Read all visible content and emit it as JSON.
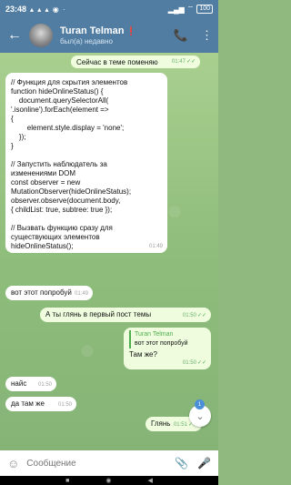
{
  "statusbar": {
    "time": "23:48",
    "icons": "▴ ▴ ▴ ◉ ·",
    "signal": "▂▄▆",
    "wifi": "⌔",
    "battery": "100"
  },
  "header": {
    "back_icon": "←",
    "name": "Turan Telman",
    "badge": "❗",
    "status": "был(а) недавно",
    "call_icon": "📞",
    "menu_icon": "⋮"
  },
  "messages": [
    {
      "id": "m1",
      "dir": "out",
      "text": "Сейчас в теме поменяю",
      "time": "01:47",
      "ticks": "✓✓"
    },
    {
      "id": "m2",
      "dir": "in",
      "text": "// Функция для скрытия элементов\nfunction hideOnlineStatus() {\n    document.querySelectorAll(\n'.isonline').forEach(element =>\n{\n        element.style.display = 'none';\n    });\n}\n\n// Запустить наблюдатель за\nизменениями DOM\nconst observer = new\nMutationObserver(hideOnlineStatus);\nobserver.observe(document.body,\n{ childList: true, subtree: true });\n\n// Вызвать функцию сразу для\nсуществующих элементов\nhideOnlineStatus();",
      "time": "01:49"
    },
    {
      "id": "m3",
      "dir": "in",
      "text": "вот этот попробуй",
      "time": "01:49"
    },
    {
      "id": "m4",
      "dir": "out",
      "text": "А ты глянь в первый пост темы",
      "time": "01:50",
      "ticks": "✓✓"
    },
    {
      "id": "m5",
      "dir": "out",
      "reply_name": "Turan Telman",
      "reply_text": "вот этот попробуй",
      "text": "Там же?",
      "time": "01:50",
      "ticks": "✓✓"
    },
    {
      "id": "m6",
      "dir": "in",
      "text": "найс",
      "time": "01:50"
    },
    {
      "id": "m7",
      "dir": "in",
      "text": "да там же",
      "time": "01:50"
    },
    {
      "id": "m8",
      "dir": "out",
      "text": "Глянь",
      "time": "01:51",
      "ticks": "✓✓"
    }
  ],
  "scroll_button": {
    "icon": "⌄",
    "count": "1"
  },
  "input": {
    "emoji_icon": "☺",
    "placeholder": "Сообщение",
    "attach_icon": "📎",
    "mic_icon": "🎤"
  },
  "navbar": {
    "square": "■",
    "circle": "◉",
    "back": "◀"
  }
}
